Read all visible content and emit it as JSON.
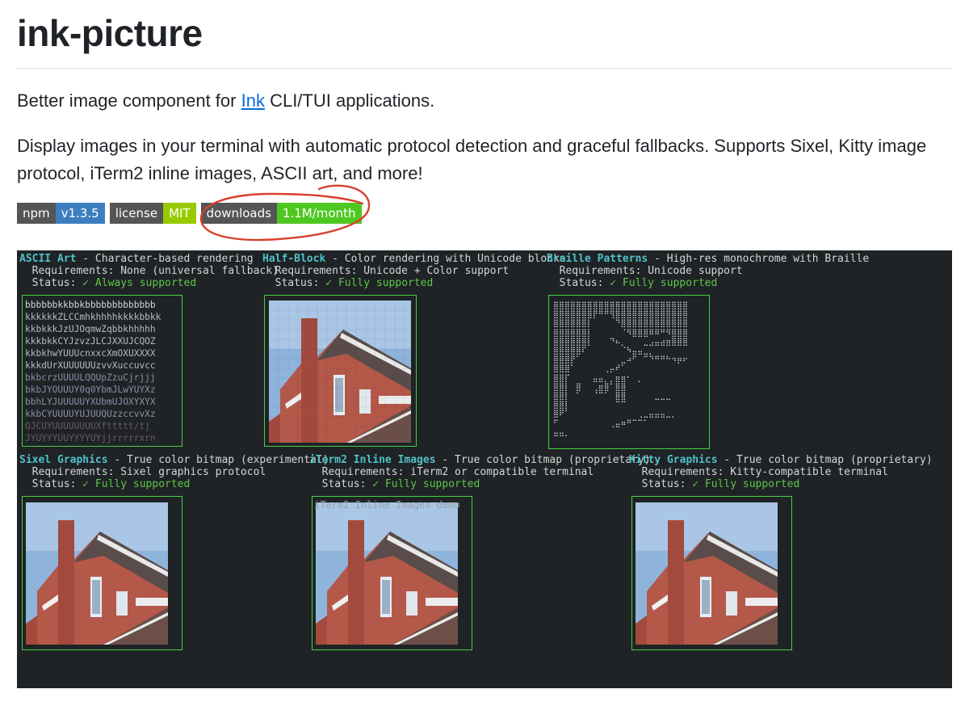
{
  "title": "ink-picture",
  "intro": {
    "prefix": "Better image component for ",
    "link": "Ink",
    "suffix": " CLI/TUI applications."
  },
  "description": "Display images in your terminal with automatic protocol detection and graceful fallbacks. Supports Sixel, Kitty image protocol, iTerm2 inline images, ASCII art, and more!",
  "badges": [
    {
      "label": "npm",
      "value": "v1.3.5",
      "color": "#3c7ebf"
    },
    {
      "label": "license",
      "value": "MIT",
      "color": "#97ca00"
    },
    {
      "label": "downloads",
      "value": "1.1M/month",
      "color": "#4ec820"
    }
  ],
  "annotation_color": "#d8402c",
  "terminal": {
    "row1": [
      {
        "name": "ASCII Art",
        "desc": " - Character-based rendering",
        "req": "  Requirements: None (universal fallback)",
        "status_label": "  Status: ",
        "status": "✓ Always supported"
      },
      {
        "name": "Half-Block",
        "desc": " - Color rendering with Unicode blocks",
        "req": "  Requirements: Unicode + Color support",
        "status_label": "  Status: ",
        "status": "✓ Fully supported"
      },
      {
        "name": "Braille Patterns",
        "desc": " - High-res monochrome with Braille",
        "req": "  Requirements: Unicode support",
        "status_label": "  Status: ",
        "status": "✓ Fully supported"
      }
    ],
    "row2": [
      {
        "name": "Sixel Graphics",
        "desc": " - True color bitmap (experimental)",
        "req": "  Requirements: Sixel graphics protocol",
        "status_label": "  Status: ",
        "status": "✓ Fully supported"
      },
      {
        "name": "iTerm2 Inline Images",
        "desc": " - True color bitmap (proprietary)",
        "req": "  Requirements: iTerm2 or compatible terminal",
        "status_label": "  Status: ",
        "status": "✓ Fully supported"
      },
      {
        "name": "Kitty Graphics",
        "desc": " - True color bitmap (proprietary)",
        "req": "  Requirements: Kitty-compatible terminal",
        "status_label": "  Status: ",
        "status": "✓ Fully supported"
      }
    ],
    "iterm_caption": "iTerm2 Inline Images demo",
    "ascii_lines": [
      "bbbbbbkkbbkbbbbbbbbbbbbb",
      "kkkkkkZLCCmhkhhhhkkkkbbkk",
      "kkbkkkJzUJOqmwZqbbkhhhhh",
      "kkkbkkCYJzvzJLCJXXUJCQOZ",
      "kkbkhwYUUUcnxxcXmOXUXXXX",
      "kkkdUrXUUUUUUzvvXuccuvcc",
      "bkbcrzUUUULQQUpZzuCjrjjj",
      "bkbJYOUUUY0q0YbmJLwYUYXz",
      "bbhLYJUUUUUYXUbmUJOXYXYX",
      "kkbCYUUUUYUJUUQUzzccvvXz",
      "QJCUYUUUUUUUUXfttttt/tj",
      "JYUYYYUUYYYYUYjjrrrrrxrn"
    ],
    "braille_lines": [
      "⣿⣿⣿⣿⣿⣿⣿⣿⣿⣿⣿⣿⣿⣿⣿⣿⣿⣿⣿⣿⣿⣿⣿⣿",
      "⣿⣿⣿⣿⣿⣿⣿⡟⠛⠛⢻⣿⣿⣿⣿⣿⣿⣿⣿⣿⣿⣿⣿⣿",
      "⣿⣿⣿⣿⣿⣿⡇⠀⠀⠀⠀⠙⣿⣿⣿⣿⣿⣿⣿⣿⣿⣿⣿⣿",
      "⣿⣿⣿⣿⣿⣿⡇⠀⠀⠀⠀⠀⠈⠻⣿⣿⣿⠿⠿⠛⠻⣿⣿⣿",
      "⣿⣿⣿⣿⣿⣿⡇⠀⠀⠀⠙⠦⡀⠀⠀⠀⣀⣠⣤⣴⣶⣿⣿⣿",
      "⣿⣿⣿⣿⣿⠏⠀⠀⠀⠀⠀⠀⠈⠳⣤⣤⣀⡀⠀⠀⠀⠀⠀⠀",
      "⣿⣿⣿⡟⠁⠀⠀⠀⠀⠀⠀⠀⣀⠴⠋⠀⠉⠙⠛⠛⠓⠲⡶⠖",
      "⣿⣿⣿⠁⠀⠀⠀⠀⠀⢀⡤⠞⠁⠀⠀⠀⠀⠀⠀⠀⠀⠀⠀⠀",
      "⣿⣿⡏⠀⠀⠀⠀⣤⣤⡀⡀⣶⣶⠂⠀⡀⠀⠀⠀⠀⠀⠀⠀⠀",
      "⣿⣿⡇⠀⣿⠀⠀⢀⣶⣿⠁⣿⣿⠀⠀⠀⠀⠀⠀⠀⠀⠀⠀⠀",
      "⣿⣿⡇⠀⠁⠀⠀⠈⠉⠁⠀⣿⣿⠀⠀⠀⠀⠀⣀⣀⣀⠀⠀⠀",
      "⣿⣿⡇⠀⠀⠀⠀⠀⠀⠀⠀⠉⠉⠀⠀⠀⠀⠀⠀⠀⠀⠀⠀⠀",
      "⣿⠟⠁⠀⠀⠀⠀⠀⠀⠀⠀⠀⠀⠀⠀⢀⣀⣤⣤⣤⣀⡀⠀⠀",
      "⠋⠀⠀⠀⠀⠀⠀⠀⠀⠀⢀⣤⠶⠛⠉⠉⠁⠀⠀⠀⠀⠀⠀⠀",
      "⣤⣤⡀⠀⠀⠀⠀⠀⠀⠀⠀⠀⠀⠀⠀⠀⠀⠀⠀⠀⠀⠀⠀⠀"
    ]
  }
}
